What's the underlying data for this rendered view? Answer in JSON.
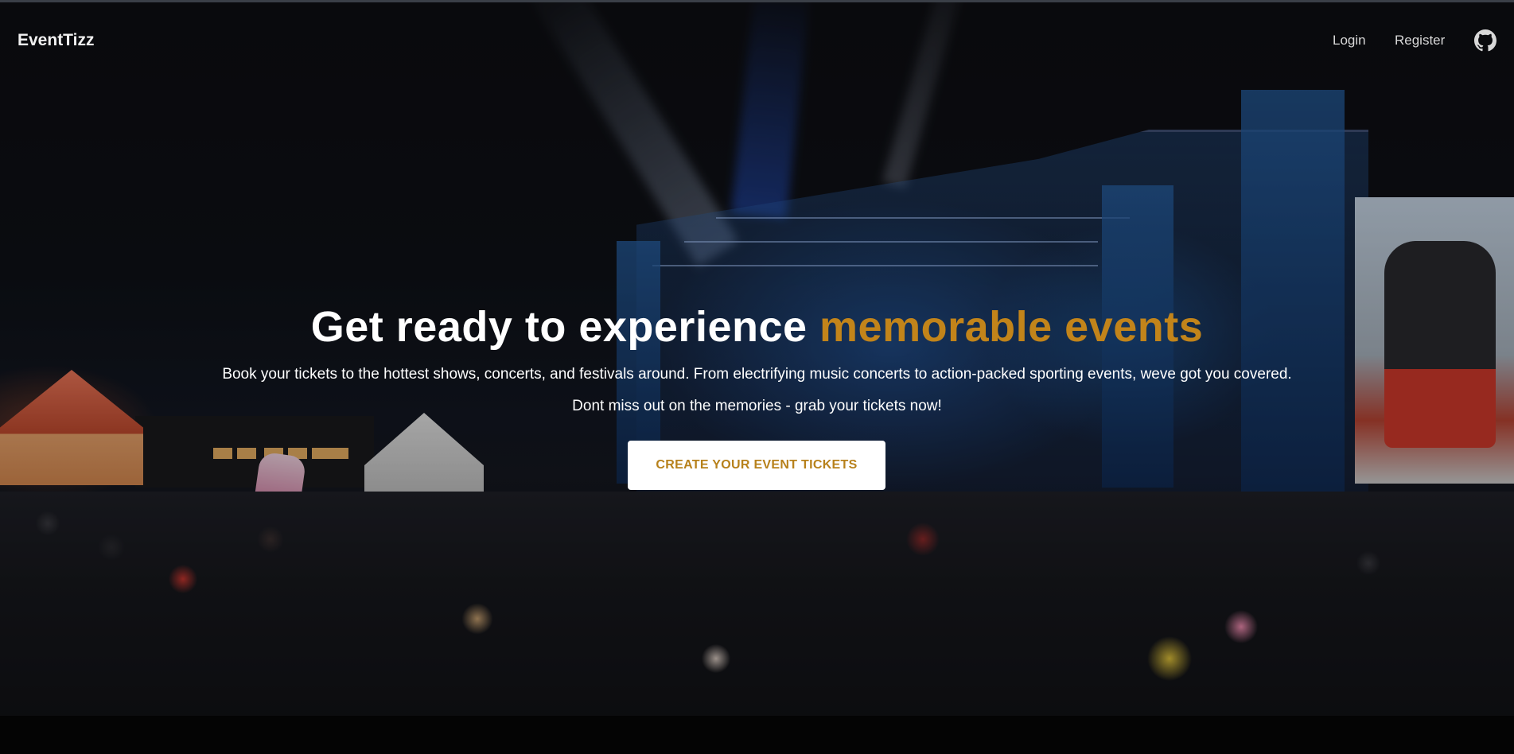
{
  "nav": {
    "brand": "EventTizz",
    "links": [
      {
        "label": "Login"
      },
      {
        "label": "Register"
      }
    ],
    "github_icon": "github-icon"
  },
  "hero": {
    "title_plain": "Get ready to experience ",
    "title_accent": "memorable events",
    "subtitle_line1": "Book your tickets to the hottest shows, concerts, and festivals around. From electrifying music concerts to action-packed sporting events, weve got you covered.",
    "subtitle_line2": "Dont miss out on the memories - grab your tickets now!",
    "cta_label": "CREATE YOUR EVENT TICKETS",
    "background_image": "concert-crowd-stage-photo"
  },
  "colors": {
    "accent": "#c2841a",
    "cta_text": "#b7811b",
    "cta_bg": "#ffffff",
    "text": "#ffffff",
    "background": "#000000"
  }
}
